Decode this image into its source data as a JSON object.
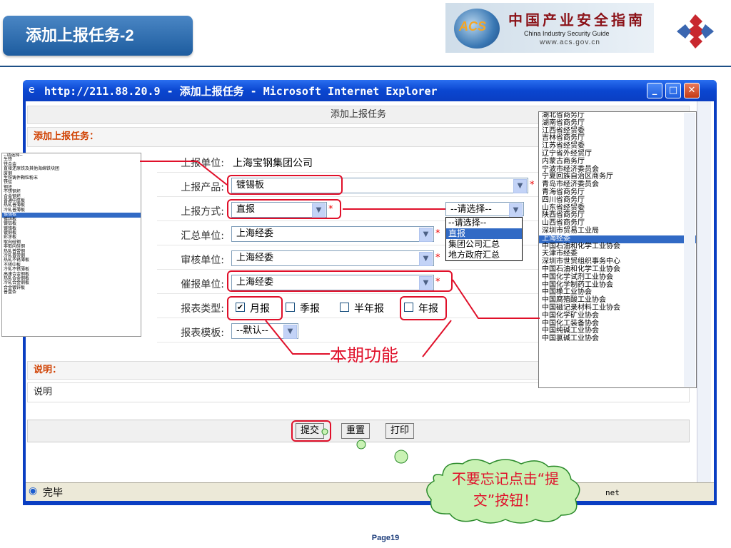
{
  "slide": {
    "title": "添加上报任务-2",
    "page": "Page19"
  },
  "logo": {
    "acs": "ACS",
    "cn": "中国产业安全指南",
    "en": "China  Industry  Security  Guide",
    "url": "www.acs.gov.cn"
  },
  "ie": {
    "title": "http://211.88.20.9 - 添加上报任务 - Microsoft Internet Explorer",
    "status": "完毕",
    "zone": "net"
  },
  "form": {
    "header": "添加上报任务",
    "section_title": "添加上报任务：",
    "fields": {
      "unit": {
        "label": "上报单位:",
        "value": "上海宝钢集团公司"
      },
      "product": {
        "label": "上报产品:",
        "value": "镀锡板"
      },
      "method": {
        "label": "上报方式:",
        "value": "直报"
      },
      "summary": {
        "label": "汇总单位:",
        "value": "上海经委"
      },
      "review": {
        "label": "审核单位:",
        "value": "上海经委"
      },
      "urge": {
        "label": "催报单位:",
        "value": "上海经委"
      },
      "report_type": {
        "label": "报表类型:",
        "options": [
          "月报",
          "季报",
          "半年报",
          "年报"
        ]
      },
      "template": {
        "label": "报表模板:",
        "value": "--默认--"
      }
    },
    "required_mark": "*",
    "notes_title": "说明：",
    "notes_text": "说明",
    "buttons": {
      "submit": "提交",
      "reset": "重置",
      "print": "打印"
    }
  },
  "method_dropdown": {
    "selected": "--请选择--",
    "options": [
      "--请选择--",
      "直报",
      "集团公司汇总",
      "地方政府汇总"
    ]
  },
  "product_list": [
    "--请选择--",
    "生铁",
    "铁合金",
    "直接还原铁及其他海绵铁块团",
    "废钢",
    "生铁铸件颗粒粉末",
    "铁锭",
    "钢坯",
    "不锈钢坯",
    "合金钢坯",
    "普通中厚板",
    "热轧普薄板",
    "冷轧普薄板",
    "镀锡板",
    "镀锌板",
    "镀铝板",
    "镀铬板",
    "镀铜板",
    "彩涂板",
    "取向硅钢",
    "非取向硅钢",
    "热轧普带钢",
    "冷轧普带钢",
    "热轧不锈薄板",
    "不锈中板",
    "冷轧不锈薄板",
    "高速合金钢板",
    "热轧合金钢板",
    "冷轧合金钢板",
    "合金镀锌板",
    "普盘条"
  ],
  "org_list": [
    "湖北省商务厅",
    "湖南省商务厅",
    "江西省经贸委",
    "吉林省商务厅",
    "江苏省经贸委",
    "辽宁省外经贸厅",
    "内蒙古商务厅",
    "宁波市经济委员会",
    "宁夏回族自治区商务厅",
    "青岛市经济委员会",
    "青海省商务厅",
    "四川省商务厅",
    "山东省经贸委",
    "陕西省商务厅",
    "山西省商务厅",
    "深圳市贸易工业局",
    "上海经委",
    "中国石油和化学工业协会",
    "天津市经委",
    "深圳市世贸组织事务中心",
    "中国石油和化学工业协会",
    "中国化学试剂工业协会",
    "中国化学制药工业协会",
    "中国橡工业协会",
    "中国腐殖酸工业协会",
    "中国磁记录材料工业协会",
    "中国化学矿业协会",
    "中国化工装备协会",
    "中国纯碱工业协会",
    "中国氯碱工业协会"
  ],
  "annotations": {
    "current_function": "本期功能",
    "reminder": "不要忘记点击“提交”按钮！"
  },
  "colors": {
    "slide_title_bg": "#2a6db0",
    "ie_blue": "#0a46d0",
    "highlight": "#e0102a",
    "selection": "#316ac5"
  }
}
